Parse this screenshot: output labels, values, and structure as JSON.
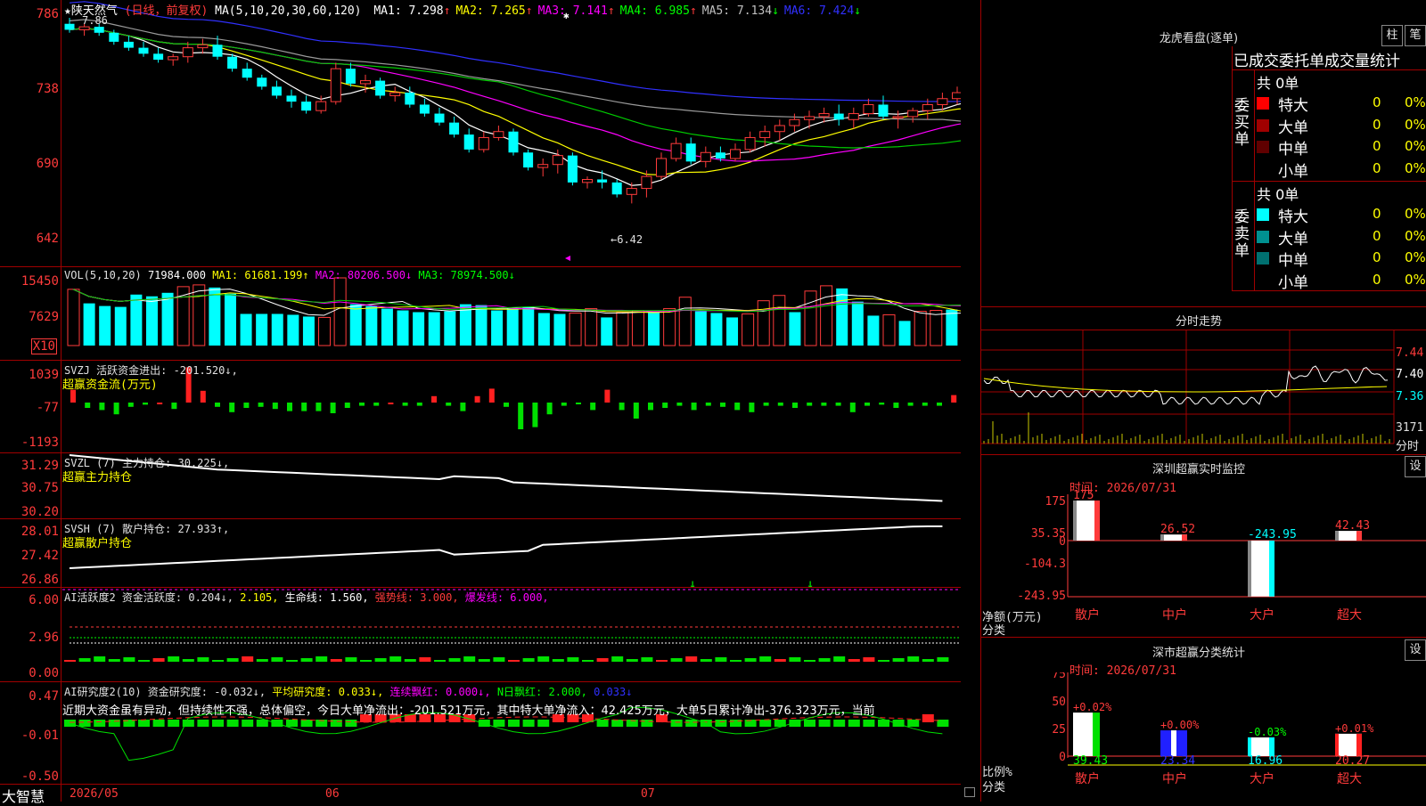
{
  "stock": {
    "name": "★陕天然气",
    "period": "(日线，前复权)",
    "ma_title": "MA(5,10,20,30,60,120)",
    "ma": [
      {
        "label": "MA1:",
        "value": "7.298",
        "arrow": "↑",
        "color": "#ffffff"
      },
      {
        "label": "MA2:",
        "value": "7.265",
        "arrow": "↑",
        "color": "#ffff00"
      },
      {
        "label": "MA3:",
        "value": "7.141",
        "arrow": "↑",
        "color": "#ff00ff"
      },
      {
        "label": "MA4:",
        "value": "6.985",
        "arrow": "↑",
        "color": "#00ff00"
      },
      {
        "label": "MA5:",
        "value": "7.134",
        "arrow": "↓",
        "color": "#c0c0c0"
      },
      {
        "label": "MA6:",
        "value": "7.424",
        "arrow": "↓",
        "color": "#3030ff"
      }
    ],
    "high_mark": "7.86",
    "low_mark": "←6.42",
    "price_axis": [
      "786",
      "738",
      "690",
      "642"
    ]
  },
  "vol": {
    "title": "VOL(5,10,20)",
    "value": "71984.000",
    "ma1": "MA1: 61681.199↑",
    "ma2": "MA2: 80206.500↓",
    "ma3": "MA3: 78974.500↓",
    "axis": [
      "15450",
      "7629",
      "X10"
    ]
  },
  "svzj": {
    "title": "SVZJ  活跃资金进出: -201.520↓,",
    "subtitle": "超赢资金流(万元)",
    "axis": [
      "1039",
      "-77",
      "-1193"
    ]
  },
  "svzl": {
    "title": "SVZL (7) 主力持仓: 30.225↓,",
    "subtitle": "超赢主力持仓",
    "axis": [
      "31.29",
      "30.75",
      "30.20"
    ]
  },
  "svsh": {
    "title": "SVSH (7) 散户持仓: 27.933↑,",
    "subtitle": "超赢散户持仓",
    "axis": [
      "28.01",
      "27.42",
      "26.86"
    ]
  },
  "ai1": {
    "t1": "AI活跃度2 资金活跃度: 0.204↓,",
    "t2": "2.105,",
    "t3": "生命线: 1.560,",
    "t4": "强势线: 3.000,",
    "t5": "爆发线: 6.000,",
    "axis": [
      "6.00",
      "2.96",
      "0.00"
    ]
  },
  "ai2": {
    "t1": "AI研究度2(10) 资金研究度: -0.032↓,",
    "t2": "平均研究度: 0.033↓,",
    "t3": "连续飘红: 0.000↓,",
    "t4": "N日飘红: 2.000,",
    "t5": "0.033↓",
    "desc": "近期大资金虽有异动，但持续性不强，总体偏空，今日大单净流出：-201.521万元，其中特大单净流入：42.425万元，大单5日累计净出-376.323万元，当前",
    "axis": [
      "0.47",
      "-0.01",
      "-0.50"
    ]
  },
  "bottom": {
    "brand": "大智慧",
    "dates": [
      "2026/05",
      "06",
      "07"
    ]
  },
  "lhb": {
    "title": "龙虎看盘(逐单)",
    "btn1": "柱",
    "btn2": "笔",
    "header": "已成交委托单成交量统计",
    "buy_label": "委买单",
    "sell_label": "委卖单",
    "buy_total": "共 0单",
    "sell_total": "共 0单",
    "buy_rows": [
      {
        "name": "特大",
        "count": "0",
        "pct": "0%",
        "color": "#ff0000"
      },
      {
        "name": "大单",
        "count": "0",
        "pct": "0%",
        "color": "#a00000"
      },
      {
        "name": "中单",
        "count": "0",
        "pct": "0%",
        "color": "#600000"
      },
      {
        "name": "小单",
        "count": "0",
        "pct": "0%",
        "color": ""
      }
    ],
    "sell_rows": [
      {
        "name": "特大",
        "count": "0",
        "pct": "0%",
        "color": "#00ffff"
      },
      {
        "name": "大单",
        "count": "0",
        "pct": "0%",
        "color": "#009090"
      },
      {
        "name": "中单",
        "count": "0",
        "pct": "0%",
        "color": "#007070"
      },
      {
        "name": "小单",
        "count": "0",
        "pct": "0%",
        "color": ""
      }
    ]
  },
  "fenshi": {
    "title": "分时走势",
    "axis": [
      "7.44",
      "7.40",
      "7.36"
    ],
    "vol_axis": [
      "3171",
      "分时"
    ]
  },
  "sz_monitor": {
    "title": "深圳超赢实时监控",
    "btn": "设",
    "time": "时间: 2026/07/31",
    "axis": [
      "175",
      "35.35",
      "0",
      "-104.3",
      "-243.95"
    ],
    "ylabel1": "净额(万元)",
    "ylabel2": "分类",
    "bars": [
      {
        "cat": "散户",
        "value": 175,
        "label": "175"
      },
      {
        "cat": "中户",
        "value": 26.52,
        "label": "26.52"
      },
      {
        "cat": "大户",
        "value": -243.95,
        "label": "-243.95"
      },
      {
        "cat": "超大",
        "value": 42.43,
        "label": "42.43"
      }
    ]
  },
  "sz_class": {
    "title": "深市超赢分类统计",
    "btn": "设",
    "time": "时间: 2026/07/31",
    "axis": [
      "75",
      "50",
      "25",
      "0"
    ],
    "ylabel1": "比例%",
    "ylabel2": "分类",
    "bars": [
      {
        "cat": "散户",
        "value": 39.43,
        "label": "39.43",
        "pct": "+0.02%"
      },
      {
        "cat": "中户",
        "value": 23.34,
        "label": "23.34",
        "pct": "+0.00%"
      },
      {
        "cat": "大户",
        "value": 16.96,
        "label": "16.96",
        "pct": "-0.03%"
      },
      {
        "cat": "超大",
        "value": 20.27,
        "label": "20.27",
        "pct": "+0.01%"
      }
    ]
  },
  "chart_data": {
    "type": "candlestick",
    "title": "陕天然气 (日线，前复权)",
    "ylim": [
      6.42,
      7.86
    ],
    "x_labels": [
      "2026/05",
      "06",
      "07"
    ],
    "candles": [
      [
        7.82,
        7.86,
        7.76,
        7.78
      ],
      [
        7.78,
        7.82,
        7.74,
        7.8
      ],
      [
        7.8,
        7.82,
        7.74,
        7.76
      ],
      [
        7.76,
        7.78,
        7.68,
        7.7
      ],
      [
        7.7,
        7.74,
        7.64,
        7.66
      ],
      [
        7.66,
        7.7,
        7.6,
        7.62
      ],
      [
        7.62,
        7.66,
        7.56,
        7.58
      ],
      [
        7.58,
        7.62,
        7.54,
        7.6
      ],
      [
        7.6,
        7.7,
        7.56,
        7.66
      ],
      [
        7.66,
        7.72,
        7.62,
        7.68
      ],
      [
        7.68,
        7.74,
        7.58,
        7.6
      ],
      [
        7.6,
        7.62,
        7.5,
        7.52
      ],
      [
        7.52,
        7.56,
        7.44,
        7.46
      ],
      [
        7.46,
        7.48,
        7.38,
        7.4
      ],
      [
        7.4,
        7.44,
        7.32,
        7.34
      ],
      [
        7.34,
        7.38,
        7.26,
        7.3
      ],
      [
        7.3,
        7.34,
        7.22,
        7.24
      ],
      [
        7.24,
        7.34,
        7.22,
        7.3
      ],
      [
        7.3,
        7.56,
        7.28,
        7.52
      ],
      [
        7.52,
        7.56,
        7.4,
        7.42
      ],
      [
        7.42,
        7.48,
        7.36,
        7.44
      ],
      [
        7.44,
        7.46,
        7.32,
        7.34
      ],
      [
        7.34,
        7.4,
        7.3,
        7.36
      ],
      [
        7.36,
        7.4,
        7.26,
        7.28
      ],
      [
        7.28,
        7.32,
        7.2,
        7.22
      ],
      [
        7.22,
        7.26,
        7.14,
        7.16
      ],
      [
        7.16,
        7.2,
        7.06,
        7.08
      ],
      [
        7.08,
        7.12,
        6.96,
        6.98
      ],
      [
        6.98,
        7.1,
        6.96,
        7.06
      ],
      [
        7.06,
        7.14,
        7.04,
        7.1
      ],
      [
        7.1,
        7.12,
        6.94,
        6.96
      ],
      [
        6.96,
        6.98,
        6.84,
        6.86
      ],
      [
        6.86,
        6.92,
        6.8,
        6.88
      ],
      [
        6.88,
        6.98,
        6.82,
        6.94
      ],
      [
        6.94,
        6.96,
        6.74,
        6.76
      ],
      [
        6.76,
        6.8,
        6.72,
        6.78
      ],
      [
        6.78,
        6.84,
        6.72,
        6.76
      ],
      [
        6.76,
        6.78,
        6.66,
        6.68
      ],
      [
        6.68,
        6.76,
        6.62,
        6.72
      ],
      [
        6.72,
        6.84,
        6.66,
        6.8
      ],
      [
        6.8,
        6.96,
        6.78,
        6.92
      ],
      [
        6.92,
        7.06,
        6.9,
        7.02
      ],
      [
        7.02,
        7.06,
        6.88,
        6.9
      ],
      [
        6.9,
        7.0,
        6.86,
        6.96
      ],
      [
        6.96,
        7.0,
        6.9,
        6.92
      ],
      [
        6.92,
        7.02,
        6.9,
        6.98
      ],
      [
        6.98,
        7.1,
        6.96,
        7.06
      ],
      [
        7.06,
        7.14,
        7.0,
        7.1
      ],
      [
        7.1,
        7.18,
        7.04,
        7.14
      ],
      [
        7.14,
        7.22,
        7.1,
        7.18
      ],
      [
        7.18,
        7.24,
        7.12,
        7.2
      ],
      [
        7.2,
        7.26,
        7.16,
        7.22
      ],
      [
        7.22,
        7.28,
        7.14,
        7.18
      ],
      [
        7.18,
        7.26,
        7.12,
        7.22
      ],
      [
        7.22,
        7.32,
        7.2,
        7.28
      ],
      [
        7.28,
        7.34,
        7.18,
        7.2
      ],
      [
        7.2,
        7.24,
        7.12,
        7.2
      ],
      [
        7.2,
        7.26,
        7.16,
        7.24
      ],
      [
        7.24,
        7.32,
        7.18,
        7.28
      ],
      [
        7.28,
        7.36,
        7.24,
        7.32
      ],
      [
        7.32,
        7.4,
        7.28,
        7.36
      ],
      [
        7.36,
        7.4,
        7.3,
        7.32
      ]
    ],
    "volume": [
      {
        "v": 12.8,
        "up": true
      },
      {
        "v": 9.6,
        "up": false
      },
      {
        "v": 9.0,
        "up": false
      },
      {
        "v": 8.8,
        "up": false
      },
      {
        "v": 11.6,
        "up": false
      },
      {
        "v": 11.2,
        "up": false
      },
      {
        "v": 12.0,
        "up": false
      },
      {
        "v": 13.4,
        "up": true
      },
      {
        "v": 13.8,
        "up": true
      },
      {
        "v": 13.2,
        "up": false
      },
      {
        "v": 11.8,
        "up": false
      },
      {
        "v": 7.2,
        "up": false
      },
      {
        "v": 7.2,
        "up": false
      },
      {
        "v": 7.2,
        "up": false
      },
      {
        "v": 7.0,
        "up": false
      },
      {
        "v": 6.6,
        "up": false
      },
      {
        "v": 6.4,
        "up": true
      },
      {
        "v": 15.4,
        "up": true
      },
      {
        "v": 9.4,
        "up": false
      },
      {
        "v": 9.0,
        "up": false
      },
      {
        "v": 8.4,
        "up": false
      },
      {
        "v": 8.0,
        "up": false
      },
      {
        "v": 7.6,
        "up": false
      },
      {
        "v": 7.6,
        "up": false
      },
      {
        "v": 7.8,
        "up": false
      },
      {
        "v": 9.4,
        "up": false
      },
      {
        "v": 9.2,
        "up": false
      },
      {
        "v": 8.0,
        "up": false
      },
      {
        "v": 8.4,
        "up": false
      },
      {
        "v": 8.8,
        "up": false
      },
      {
        "v": 7.4,
        "up": false
      },
      {
        "v": 7.2,
        "up": false
      },
      {
        "v": 7.4,
        "up": true
      },
      {
        "v": 8.4,
        "up": true
      },
      {
        "v": 6.4,
        "up": false
      },
      {
        "v": 7.6,
        "up": true
      },
      {
        "v": 8.0,
        "up": true
      },
      {
        "v": 7.6,
        "up": false
      },
      {
        "v": 8.4,
        "up": true
      },
      {
        "v": 11.0,
        "up": true
      },
      {
        "v": 7.8,
        "up": false
      },
      {
        "v": 7.4,
        "up": false
      },
      {
        "v": 6.4,
        "up": false
      },
      {
        "v": 7.2,
        "up": true
      },
      {
        "v": 10.2,
        "up": true
      },
      {
        "v": 11.4,
        "up": true
      },
      {
        "v": 7.6,
        "up": false
      },
      {
        "v": 12.4,
        "up": true
      },
      {
        "v": 13.6,
        "up": true
      },
      {
        "v": 13.0,
        "up": false
      },
      {
        "v": 10.0,
        "up": false
      },
      {
        "v": 6.8,
        "up": false
      },
      {
        "v": 7.0,
        "up": true
      },
      {
        "v": 5.6,
        "up": false
      },
      {
        "v": 7.8,
        "up": true
      },
      {
        "v": 8.0,
        "up": true
      },
      {
        "v": 8.2,
        "up": false
      },
      {
        "v": 7.4,
        "up": false
      }
    ],
    "flow": [
      24,
      -10,
      -14,
      -22,
      -8,
      -4,
      0,
      -12,
      66,
      22,
      -8,
      -18,
      -10,
      -8,
      -12,
      -16,
      -16,
      -16,
      -20,
      -10,
      -6,
      -6,
      0,
      -6,
      -6,
      12,
      -6,
      -16,
      12,
      26,
      -8,
      -50,
      -46,
      -22,
      -6,
      -2,
      -14,
      24,
      -14,
      -30,
      -14,
      -10,
      -6,
      -14,
      -6,
      -8,
      -14,
      -18,
      -6,
      -6,
      -10,
      -6,
      -6,
      -6,
      -18,
      -6,
      -4,
      -10,
      -6,
      -6,
      -6,
      14,
      -10,
      -6,
      -18
    ]
  }
}
